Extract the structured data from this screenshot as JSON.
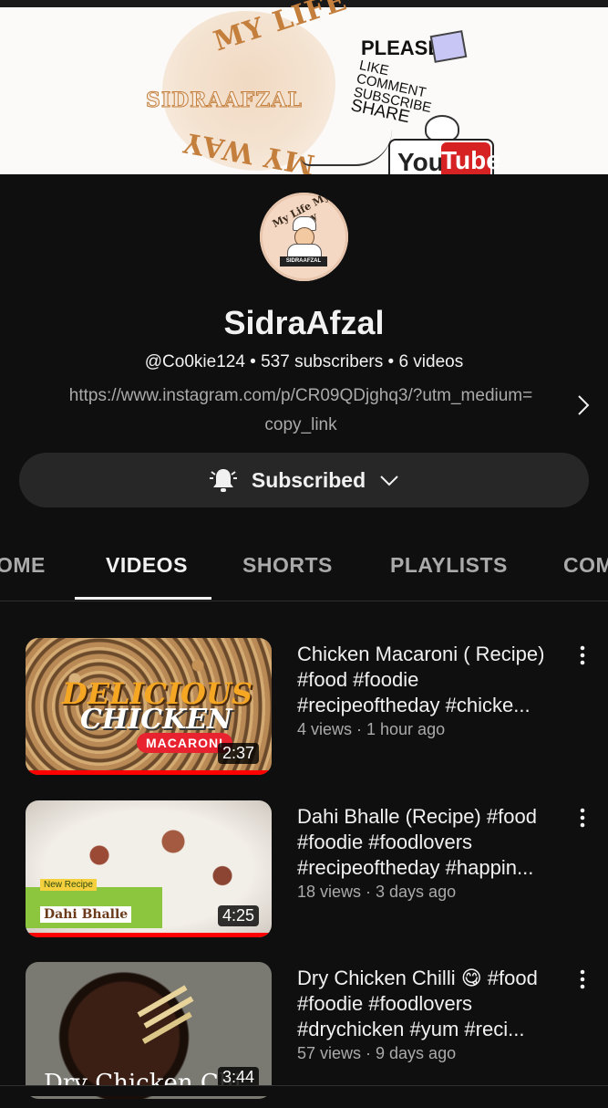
{
  "banner": {
    "arc_top": "MY LIFE",
    "arc_bottom": "MY WAY",
    "brand": "SIDRAAFZAL",
    "please": "PLEASE",
    "actions": [
      "LIKE",
      "COMMENT",
      "SUBSCRIBE",
      "SHARE"
    ],
    "yt_you": "You",
    "yt_tube": "Tube"
  },
  "avatar": {
    "ring_text": "My Life My Way",
    "badge": "SIDRAAFZAL"
  },
  "channel": {
    "name": "SidraAfzal",
    "meta": "@Co0kie124 • 537 subscribers • 6 videos",
    "link_line1": "https://www.instagram.com/p/CR09QDjghq3/?utm_medium=",
    "link_line2": "copy_link"
  },
  "subscribe": {
    "label": "Subscribed"
  },
  "tabs": [
    {
      "label": "OME"
    },
    {
      "label": "VIDEOS",
      "active": true
    },
    {
      "label": "SHORTS"
    },
    {
      "label": "PLAYLISTS"
    },
    {
      "label": "COM"
    }
  ],
  "videos": [
    {
      "title": "Chicken Macaroni ( Recipe) #food #foodie #recipeoftheday #chicke...",
      "meta": "4 views · 1 hour ago",
      "duration": "2:37",
      "thumb_w1": "DELICIOUS",
      "thumb_w2": "CHICKEN",
      "thumb_w3": "MACARONI",
      "progress": 1.0
    },
    {
      "title": "Dahi Bhalle (Recipe) #food #foodie #foodlovers #recipeoftheday #happin...",
      "meta": "18 views · 3 days ago",
      "duration": "4:25",
      "thumb_tag": "New Recipe",
      "thumb_name": "Dahi Bhalle",
      "progress": 1.0
    },
    {
      "title": "Dry Chicken Chilli 😋 #food #foodie  #foodlovers #drychicken #yum  #reci...",
      "meta": "57 views · 9 days ago",
      "duration": "3:44",
      "thumb_caption": "Dry Chicken Chi",
      "progress": 0
    }
  ]
}
